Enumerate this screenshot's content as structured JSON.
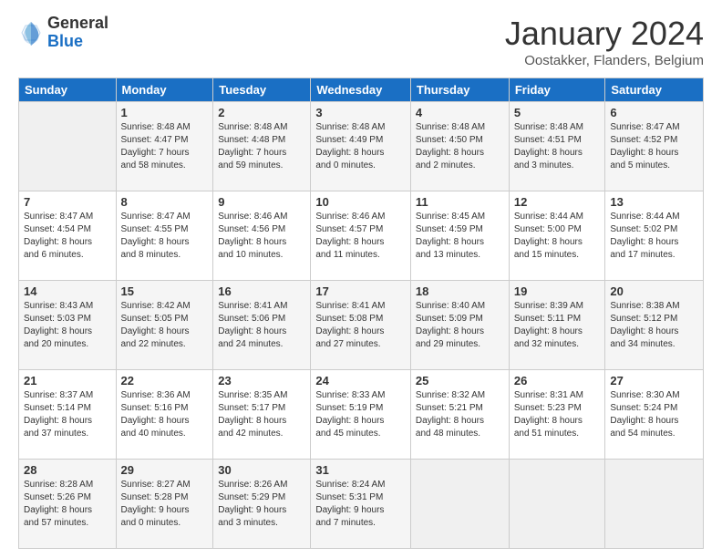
{
  "header": {
    "logo_general": "General",
    "logo_blue": "Blue",
    "title": "January 2024",
    "subtitle": "Oostakker, Flanders, Belgium"
  },
  "weekdays": [
    "Sunday",
    "Monday",
    "Tuesday",
    "Wednesday",
    "Thursday",
    "Friday",
    "Saturday"
  ],
  "weeks": [
    [
      {
        "day": "",
        "info": ""
      },
      {
        "day": "1",
        "info": "Sunrise: 8:48 AM\nSunset: 4:47 PM\nDaylight: 7 hours\nand 58 minutes."
      },
      {
        "day": "2",
        "info": "Sunrise: 8:48 AM\nSunset: 4:48 PM\nDaylight: 7 hours\nand 59 minutes."
      },
      {
        "day": "3",
        "info": "Sunrise: 8:48 AM\nSunset: 4:49 PM\nDaylight: 8 hours\nand 0 minutes."
      },
      {
        "day": "4",
        "info": "Sunrise: 8:48 AM\nSunset: 4:50 PM\nDaylight: 8 hours\nand 2 minutes."
      },
      {
        "day": "5",
        "info": "Sunrise: 8:48 AM\nSunset: 4:51 PM\nDaylight: 8 hours\nand 3 minutes."
      },
      {
        "day": "6",
        "info": "Sunrise: 8:47 AM\nSunset: 4:52 PM\nDaylight: 8 hours\nand 5 minutes."
      }
    ],
    [
      {
        "day": "7",
        "info": "Sunrise: 8:47 AM\nSunset: 4:54 PM\nDaylight: 8 hours\nand 6 minutes."
      },
      {
        "day": "8",
        "info": "Sunrise: 8:47 AM\nSunset: 4:55 PM\nDaylight: 8 hours\nand 8 minutes."
      },
      {
        "day": "9",
        "info": "Sunrise: 8:46 AM\nSunset: 4:56 PM\nDaylight: 8 hours\nand 10 minutes."
      },
      {
        "day": "10",
        "info": "Sunrise: 8:46 AM\nSunset: 4:57 PM\nDaylight: 8 hours\nand 11 minutes."
      },
      {
        "day": "11",
        "info": "Sunrise: 8:45 AM\nSunset: 4:59 PM\nDaylight: 8 hours\nand 13 minutes."
      },
      {
        "day": "12",
        "info": "Sunrise: 8:44 AM\nSunset: 5:00 PM\nDaylight: 8 hours\nand 15 minutes."
      },
      {
        "day": "13",
        "info": "Sunrise: 8:44 AM\nSunset: 5:02 PM\nDaylight: 8 hours\nand 17 minutes."
      }
    ],
    [
      {
        "day": "14",
        "info": "Sunrise: 8:43 AM\nSunset: 5:03 PM\nDaylight: 8 hours\nand 20 minutes."
      },
      {
        "day": "15",
        "info": "Sunrise: 8:42 AM\nSunset: 5:05 PM\nDaylight: 8 hours\nand 22 minutes."
      },
      {
        "day": "16",
        "info": "Sunrise: 8:41 AM\nSunset: 5:06 PM\nDaylight: 8 hours\nand 24 minutes."
      },
      {
        "day": "17",
        "info": "Sunrise: 8:41 AM\nSunset: 5:08 PM\nDaylight: 8 hours\nand 27 minutes."
      },
      {
        "day": "18",
        "info": "Sunrise: 8:40 AM\nSunset: 5:09 PM\nDaylight: 8 hours\nand 29 minutes."
      },
      {
        "day": "19",
        "info": "Sunrise: 8:39 AM\nSunset: 5:11 PM\nDaylight: 8 hours\nand 32 minutes."
      },
      {
        "day": "20",
        "info": "Sunrise: 8:38 AM\nSunset: 5:12 PM\nDaylight: 8 hours\nand 34 minutes."
      }
    ],
    [
      {
        "day": "21",
        "info": "Sunrise: 8:37 AM\nSunset: 5:14 PM\nDaylight: 8 hours\nand 37 minutes."
      },
      {
        "day": "22",
        "info": "Sunrise: 8:36 AM\nSunset: 5:16 PM\nDaylight: 8 hours\nand 40 minutes."
      },
      {
        "day": "23",
        "info": "Sunrise: 8:35 AM\nSunset: 5:17 PM\nDaylight: 8 hours\nand 42 minutes."
      },
      {
        "day": "24",
        "info": "Sunrise: 8:33 AM\nSunset: 5:19 PM\nDaylight: 8 hours\nand 45 minutes."
      },
      {
        "day": "25",
        "info": "Sunrise: 8:32 AM\nSunset: 5:21 PM\nDaylight: 8 hours\nand 48 minutes."
      },
      {
        "day": "26",
        "info": "Sunrise: 8:31 AM\nSunset: 5:23 PM\nDaylight: 8 hours\nand 51 minutes."
      },
      {
        "day": "27",
        "info": "Sunrise: 8:30 AM\nSunset: 5:24 PM\nDaylight: 8 hours\nand 54 minutes."
      }
    ],
    [
      {
        "day": "28",
        "info": "Sunrise: 8:28 AM\nSunset: 5:26 PM\nDaylight: 8 hours\nand 57 minutes."
      },
      {
        "day": "29",
        "info": "Sunrise: 8:27 AM\nSunset: 5:28 PM\nDaylight: 9 hours\nand 0 minutes."
      },
      {
        "day": "30",
        "info": "Sunrise: 8:26 AM\nSunset: 5:29 PM\nDaylight: 9 hours\nand 3 minutes."
      },
      {
        "day": "31",
        "info": "Sunrise: 8:24 AM\nSunset: 5:31 PM\nDaylight: 9 hours\nand 7 minutes."
      },
      {
        "day": "",
        "info": ""
      },
      {
        "day": "",
        "info": ""
      },
      {
        "day": "",
        "info": ""
      }
    ]
  ]
}
